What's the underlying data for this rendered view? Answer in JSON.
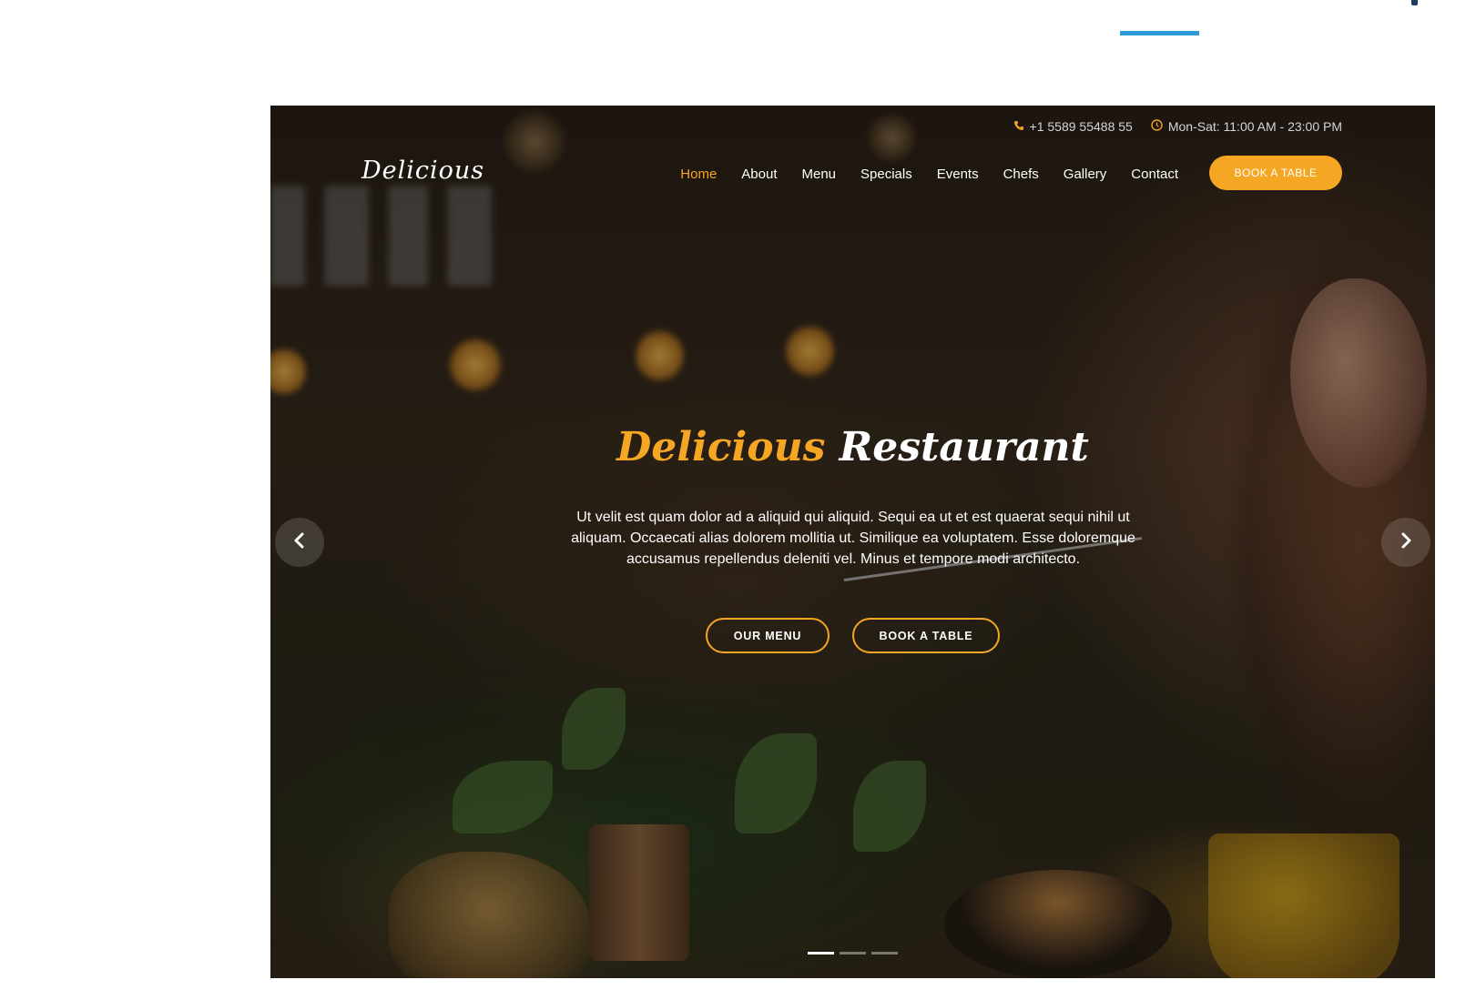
{
  "topbar": {
    "phone_icon": "phone-icon",
    "phone": "+1 5589 55488 55",
    "clock_icon": "clock-icon",
    "hours": "Mon-Sat: 11:00 AM - 23:00 PM"
  },
  "header": {
    "logo": "Delicious",
    "nav": [
      {
        "label": "Home",
        "active": true
      },
      {
        "label": "About"
      },
      {
        "label": "Menu"
      },
      {
        "label": "Specials"
      },
      {
        "label": "Events"
      },
      {
        "label": "Chefs"
      },
      {
        "label": "Gallery"
      },
      {
        "label": "Contact"
      }
    ],
    "book_button": "Book a Table"
  },
  "hero": {
    "title_brand": "Delicious",
    "title_rest": "Restaurant",
    "text": "Ut velit est quam dolor ad a aliquid qui aliquid. Sequi ea ut et est quaerat sequi nihil ut aliquam. Occaecati alias dolorem mollitia ut. Similique ea voluptatem. Esse doloremque accusamus repellendus deleniti vel. Minus et tempore modi architecto.",
    "cta_menu": "Our Menu",
    "cta_table": "Book a Table",
    "prev_icon": "chevron-left-icon",
    "next_icon": "chevron-right-icon",
    "slide_count": 3,
    "active_slide": 1
  },
  "colors": {
    "accent": "#f5a623",
    "blue_underline": "#2f9bd6"
  }
}
